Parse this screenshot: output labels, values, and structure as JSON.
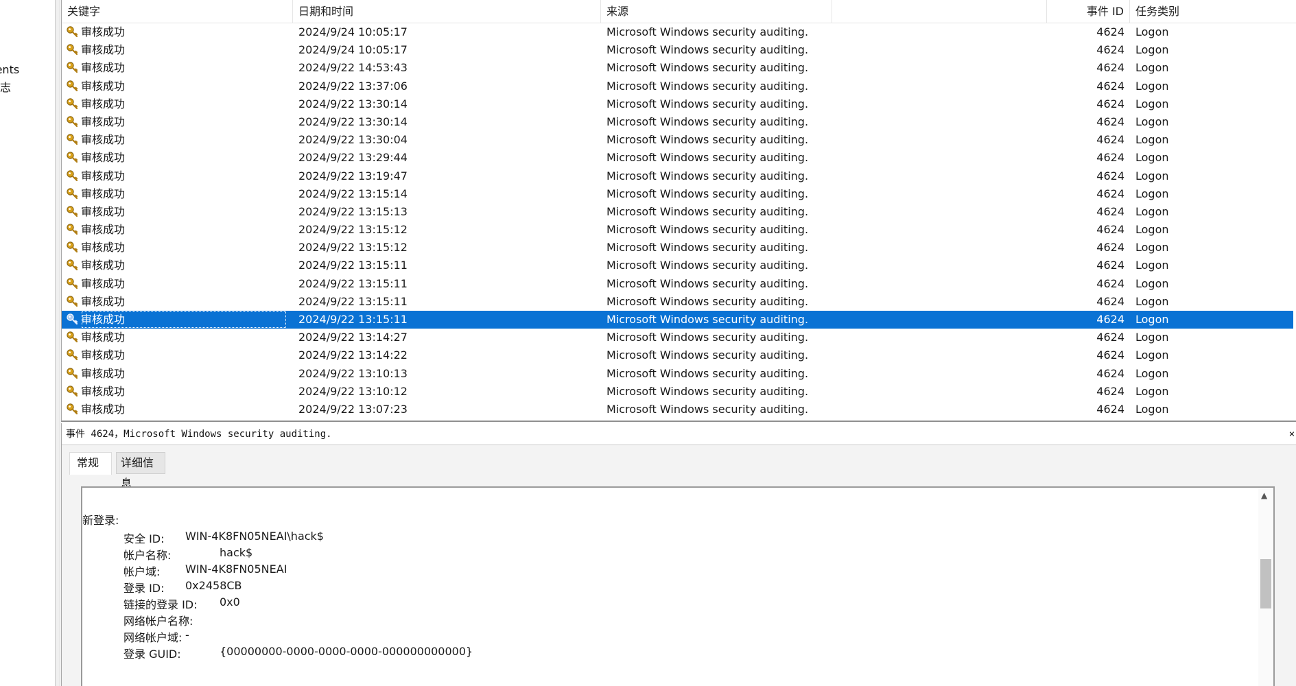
{
  "tree": {
    "items": [
      {
        "label": "Events"
      },
      {
        "label": "日志"
      }
    ]
  },
  "columns": {
    "keyword": "关键字",
    "datetime": "日期和时间",
    "source": "来源",
    "event_id": "事件 ID",
    "task": "任务类别"
  },
  "events": [
    {
      "keyword": "审核成功",
      "datetime": "2024/9/24 10:05:17",
      "source": "Microsoft Windows security auditing.",
      "event_id": "4624",
      "task": "Logon"
    },
    {
      "keyword": "审核成功",
      "datetime": "2024/9/24 10:05:17",
      "source": "Microsoft Windows security auditing.",
      "event_id": "4624",
      "task": "Logon"
    },
    {
      "keyword": "审核成功",
      "datetime": "2024/9/22 14:53:43",
      "source": "Microsoft Windows security auditing.",
      "event_id": "4624",
      "task": "Logon"
    },
    {
      "keyword": "审核成功",
      "datetime": "2024/9/22 13:37:06",
      "source": "Microsoft Windows security auditing.",
      "event_id": "4624",
      "task": "Logon"
    },
    {
      "keyword": "审核成功",
      "datetime": "2024/9/22 13:30:14",
      "source": "Microsoft Windows security auditing.",
      "event_id": "4624",
      "task": "Logon"
    },
    {
      "keyword": "审核成功",
      "datetime": "2024/9/22 13:30:14",
      "source": "Microsoft Windows security auditing.",
      "event_id": "4624",
      "task": "Logon"
    },
    {
      "keyword": "审核成功",
      "datetime": "2024/9/22 13:30:04",
      "source": "Microsoft Windows security auditing.",
      "event_id": "4624",
      "task": "Logon"
    },
    {
      "keyword": "审核成功",
      "datetime": "2024/9/22 13:29:44",
      "source": "Microsoft Windows security auditing.",
      "event_id": "4624",
      "task": "Logon"
    },
    {
      "keyword": "审核成功",
      "datetime": "2024/9/22 13:19:47",
      "source": "Microsoft Windows security auditing.",
      "event_id": "4624",
      "task": "Logon"
    },
    {
      "keyword": "审核成功",
      "datetime": "2024/9/22 13:15:14",
      "source": "Microsoft Windows security auditing.",
      "event_id": "4624",
      "task": "Logon"
    },
    {
      "keyword": "审核成功",
      "datetime": "2024/9/22 13:15:13",
      "source": "Microsoft Windows security auditing.",
      "event_id": "4624",
      "task": "Logon"
    },
    {
      "keyword": "审核成功",
      "datetime": "2024/9/22 13:15:12",
      "source": "Microsoft Windows security auditing.",
      "event_id": "4624",
      "task": "Logon"
    },
    {
      "keyword": "审核成功",
      "datetime": "2024/9/22 13:15:12",
      "source": "Microsoft Windows security auditing.",
      "event_id": "4624",
      "task": "Logon"
    },
    {
      "keyword": "审核成功",
      "datetime": "2024/9/22 13:15:11",
      "source": "Microsoft Windows security auditing.",
      "event_id": "4624",
      "task": "Logon"
    },
    {
      "keyword": "审核成功",
      "datetime": "2024/9/22 13:15:11",
      "source": "Microsoft Windows security auditing.",
      "event_id": "4624",
      "task": "Logon"
    },
    {
      "keyword": "审核成功",
      "datetime": "2024/9/22 13:15:11",
      "source": "Microsoft Windows security auditing.",
      "event_id": "4624",
      "task": "Logon"
    },
    {
      "keyword": "审核成功",
      "datetime": "2024/9/22 13:15:11",
      "source": "Microsoft Windows security auditing.",
      "event_id": "4624",
      "task": "Logon",
      "selected": true
    },
    {
      "keyword": "审核成功",
      "datetime": "2024/9/22 13:14:27",
      "source": "Microsoft Windows security auditing.",
      "event_id": "4624",
      "task": "Logon"
    },
    {
      "keyword": "审核成功",
      "datetime": "2024/9/22 13:14:22",
      "source": "Microsoft Windows security auditing.",
      "event_id": "4624",
      "task": "Logon"
    },
    {
      "keyword": "审核成功",
      "datetime": "2024/9/22 13:10:13",
      "source": "Microsoft Windows security auditing.",
      "event_id": "4624",
      "task": "Logon"
    },
    {
      "keyword": "审核成功",
      "datetime": "2024/9/22 13:10:12",
      "source": "Microsoft Windows security auditing.",
      "event_id": "4624",
      "task": "Logon"
    },
    {
      "keyword": "审核成功",
      "datetime": "2024/9/22 13:07:23",
      "source": "Microsoft Windows security auditing.",
      "event_id": "4624",
      "task": "Logon"
    }
  ],
  "detail": {
    "title": "事件 4624，Microsoft Windows security auditing.",
    "close_glyph": "×",
    "tabs": {
      "general": "常规",
      "details": "详细信息"
    },
    "heading": "新登录:",
    "fields": [
      {
        "label": "安全 ID:",
        "value": "WIN-4K8FN05NEAI\\hack$"
      },
      {
        "label": "帐户名称:",
        "value": "hack$"
      },
      {
        "label": "帐户域:",
        "value": "WIN-4K8FN05NEAI"
      },
      {
        "label": "登录 ID:",
        "value": "0x2458CB"
      },
      {
        "label": "链接的登录 ID:",
        "value": "0x0"
      },
      {
        "label": "网络帐户名称:",
        "value": "-"
      },
      {
        "label": "网络帐户域:",
        "value": "-"
      },
      {
        "label": "登录 GUID:",
        "value": "{00000000-0000-0000-0000-000000000000}"
      }
    ]
  },
  "colors": {
    "selection": "#0a72d4",
    "key_icon": "#d9a21b"
  }
}
